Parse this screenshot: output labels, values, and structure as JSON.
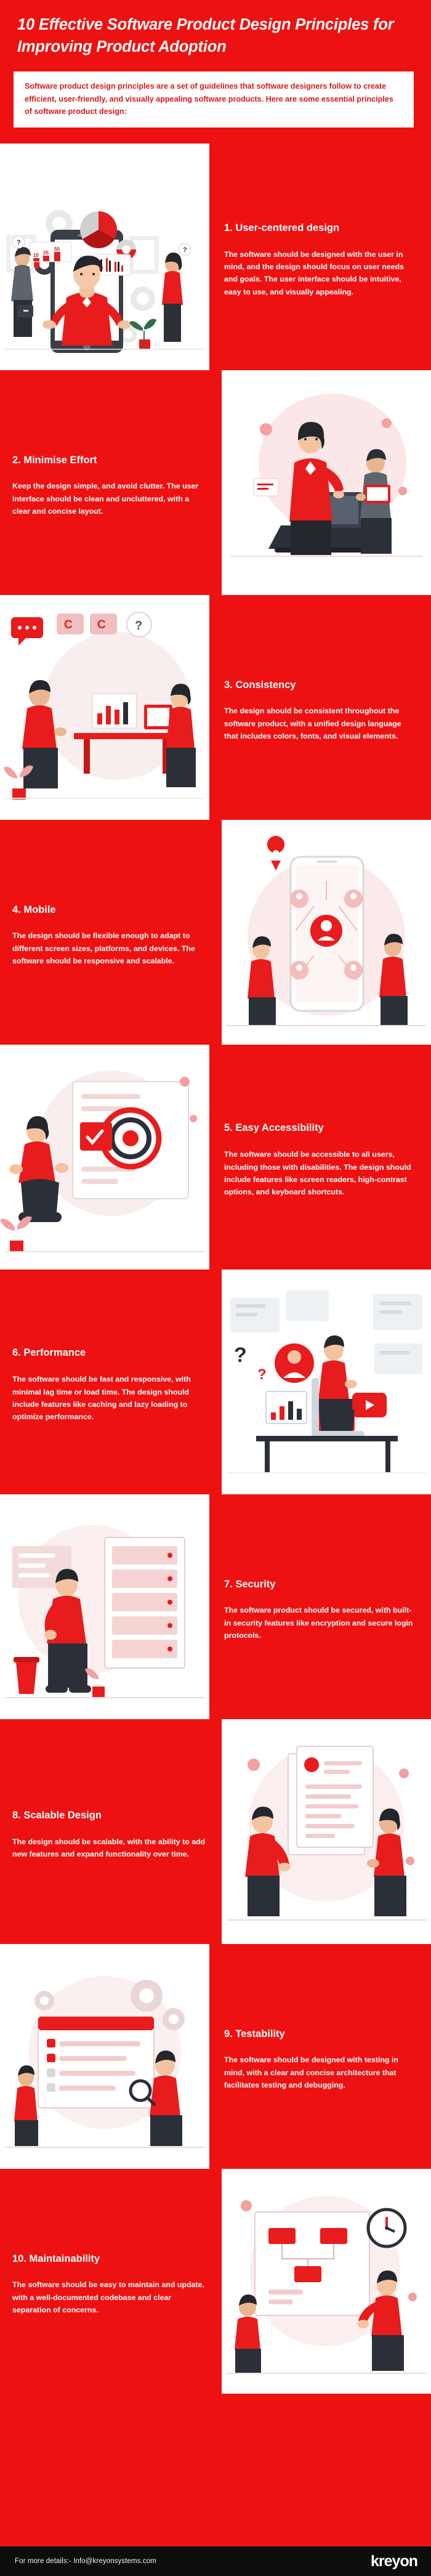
{
  "header": {
    "title": "10 Effective Software Product Design Principles for Improving Product Adoption",
    "intro": "Software product design principles are a set of guidelines that software designers follow to create efficient, user-friendly, and visually appealing software products. Here are some essential principles of software product design:"
  },
  "colors": {
    "brand_red": "#ee1111",
    "text_red": "#d51a1a",
    "white": "#ffffff",
    "footer_bg": "#0d0d0d",
    "illo_grey": "#4a4f57",
    "illo_light": "#e8e8e8",
    "illo_pink": "#f6b7b7"
  },
  "principles": [
    {
      "number": "1.",
      "title": "1. User-centered design",
      "body": "The software should be designed with the user in mind, and the design should focus on user needs and goals. The user interface should be intuitive, easy to use, and visually appealing.",
      "illustration": "team-presentation-dashboard-illustration",
      "image_side": "left"
    },
    {
      "number": "2.",
      "title": "2. Minimise Effort",
      "body": "Keep the design simple, and avoid clutter. The user interface should be clean and uncluttered, with a clear and concise layout.",
      "illustration": "woman-with-laptop-and-man-illustration",
      "image_side": "right"
    },
    {
      "number": "3.",
      "title": "3. Consistency",
      "body": "The design should be consistent throughout the software product, with a unified design language that includes colors, fonts, and visual elements.",
      "illustration": "people-with-charts-and-desk-illustration",
      "image_side": "left"
    },
    {
      "number": "4.",
      "title": "4. Mobile",
      "body": "The design should be flexible enough to adapt to different screen sizes, platforms, and devices. The software should be responsive and scalable.",
      "illustration": "mobile-phone-network-illustration",
      "image_side": "right"
    },
    {
      "number": "5.",
      "title": "5. Easy Accessibility",
      "body": "The software should be accessible to all users, including those with disabilities. The design should include features like screen readers, high-contrast options, and keyboard shortcuts.",
      "illustration": "accessibility-target-person-illustration",
      "image_side": "left"
    },
    {
      "number": "6.",
      "title": "6. Performance",
      "body": "The software should be fast and responsive, with minimal lag time or load time. The design should include features like caching and lazy loading to optimize performance.",
      "illustration": "video-streaming-performance-illustration",
      "image_side": "right"
    },
    {
      "number": "7.",
      "title": "7. Security",
      "body": "The software product should be secured, with built-in security features like encryption and secure login protocols.",
      "illustration": "secure-server-person-illustration",
      "image_side": "left"
    },
    {
      "number": "8.",
      "title": "8. Scalable Design",
      "body": "The design should be scalable, with the ability to add new features and expand functionality over time.",
      "illustration": "scalable-documents-people-illustration",
      "image_side": "right"
    },
    {
      "number": "9.",
      "title": "9. Testability",
      "body": "The software should be designed with testing in mind, with a clear and concise architecture that facilitates testing and debugging.",
      "illustration": "testing-checklist-gears-illustration",
      "image_side": "left"
    },
    {
      "number": "10.",
      "title": "10. Maintainability",
      "body": "The software should be easy to maintain and update, with a well-documented codebase and clear separation of concerns.",
      "illustration": "maintenance-flowchart-clock-illustration",
      "image_side": "right"
    }
  ],
  "footer": {
    "contact": "For more details:- Info@kreyonsystems.com",
    "logo": "kreyon"
  }
}
